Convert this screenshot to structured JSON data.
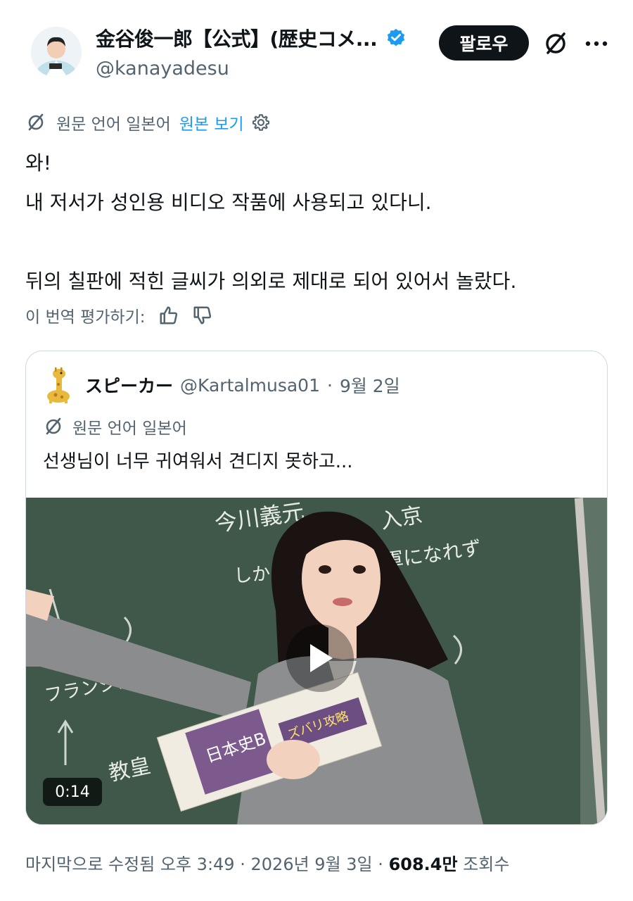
{
  "author": {
    "display_name": "金谷俊一郎【公式】(歴史コメ...",
    "handle": "@kanayadesu",
    "follow_label": "팔로우",
    "verified_icon": "verified-badge-icon"
  },
  "translation": {
    "source_label": "원문 언어 일본어",
    "show_original_label": "원본 보기"
  },
  "tweet": {
    "lines": [
      "와!",
      "내 저서가 성인용 비디오 작품에 사용되고 있다니.",
      "",
      "뒤의 칠판에 적힌 글씨가 의외로 제대로 되어 있어서 놀랐다."
    ],
    "rate_label": "이 번역 평가하기:"
  },
  "quoted": {
    "display_name": "スピーカー",
    "handle": "@Kartalmusa01",
    "separator": "·",
    "date": "9월 2일",
    "source_label": "원문 언어 일본어",
    "text": "선생님이 너무 귀여워서 견디지 못하고...",
    "video_duration": "0:14",
    "chalkboard_lines": [
      "今川義元",
      "入京",
      "しかし",
      "軍になれず",
      "フランシスコ",
      "教皇"
    ],
    "book_label": "日本史B",
    "book_banner": "ズバリ攻略"
  },
  "footer": {
    "edited_label": "마지막으로 수정됨 오후 3:49",
    "date": "2026년 9월 3일",
    "views_count": "608.4만",
    "views_label": "조회수",
    "separator": "·"
  },
  "colors": {
    "text": "#0f1419",
    "muted": "#536471",
    "link": "#1d9bf0",
    "border": "#cfd9de",
    "chalkboard": "#3d5446"
  }
}
